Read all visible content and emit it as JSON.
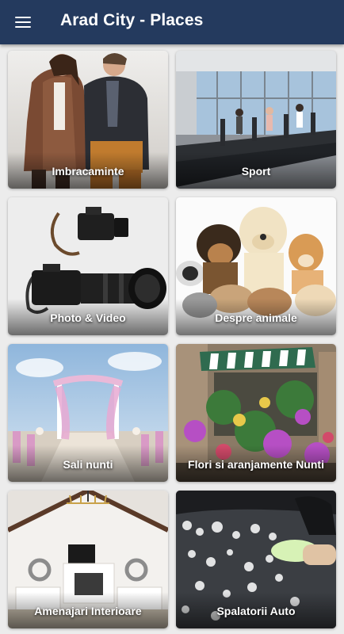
{
  "app": {
    "title": "Arad City - Places"
  },
  "categories": [
    {
      "label": "Imbracaminte"
    },
    {
      "label": "Sport"
    },
    {
      "label": "Photo & Video"
    },
    {
      "label": "Despre animale"
    },
    {
      "label": "Sali nunti"
    },
    {
      "label": "Flori si aranjamente Nunti"
    },
    {
      "label": "Amenajari Interioare"
    },
    {
      "label": "Spalatorii Auto"
    }
  ]
}
